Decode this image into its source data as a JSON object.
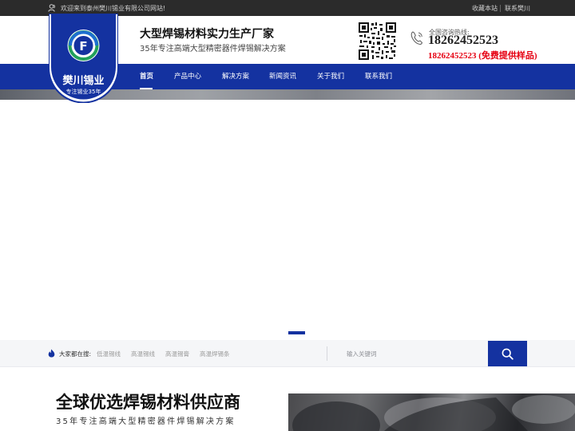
{
  "topbar": {
    "welcome": "欢迎来到泰州樊川锡业有限公司网站!",
    "favorite": "收藏本站",
    "contact": "联系樊川"
  },
  "logo": {
    "name": "樊川锡业",
    "tagline": "专注锡业35年",
    "letter": "F"
  },
  "header": {
    "title": "大型焊锡材料实力生产厂家",
    "subtitle": "35年专注高端大型精密器件焊锡解决方案",
    "hotline_label": "全国咨询热线:",
    "hotline_number": "18262452523",
    "hotline_sample": "18262452523 (免费提供样品)"
  },
  "nav": {
    "items": [
      "首页",
      "产品中心",
      "解决方案",
      "新闻资讯",
      "关于我们",
      "联系我们"
    ],
    "active": "首页"
  },
  "search": {
    "hot_label": "大家都在搜:",
    "keywords": [
      "低温锡线",
      "高温锡线",
      "高温锡膏",
      "高温焊锡条"
    ],
    "placeholder": "输入关键词"
  },
  "section": {
    "title": "全球优选焊锡材料供应商",
    "subtitle": "35年专注高端大型精密器件焊锡解决方案"
  },
  "colors": {
    "brand_blue": "#1432a0",
    "topbar": "#2b2b2b",
    "sample_red": "#e60012"
  }
}
